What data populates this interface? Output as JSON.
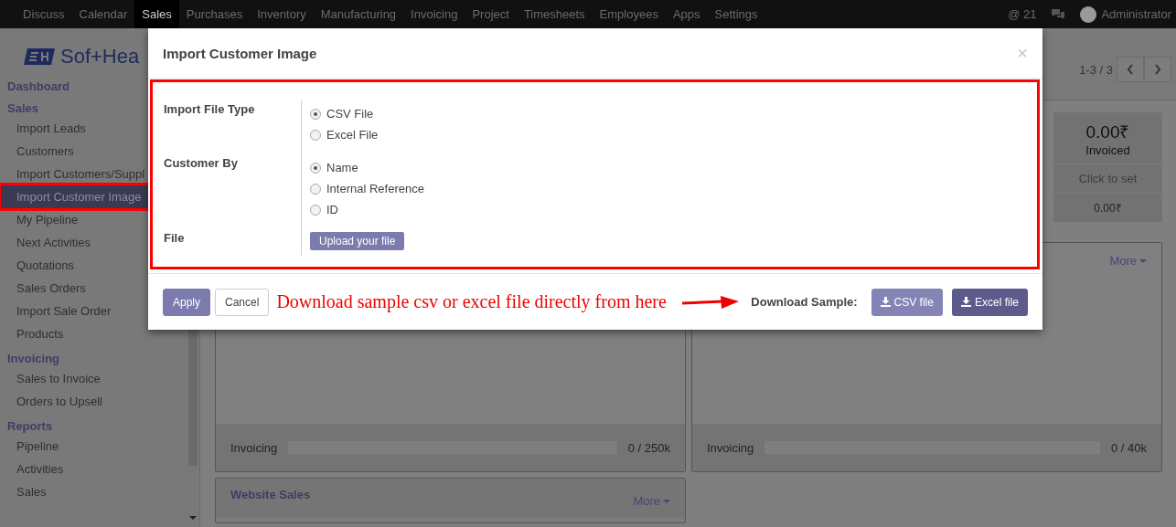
{
  "top_nav": {
    "menu": [
      {
        "label": "Discuss",
        "selected": false
      },
      {
        "label": "Calendar",
        "selected": false
      },
      {
        "label": "Sales",
        "selected": true
      },
      {
        "label": "Purchases",
        "selected": false
      },
      {
        "label": "Inventory",
        "selected": false
      },
      {
        "label": "Manufacturing",
        "selected": false
      },
      {
        "label": "Invoicing",
        "selected": false
      },
      {
        "label": "Project",
        "selected": false
      },
      {
        "label": "Timesheets",
        "selected": false
      },
      {
        "label": "Employees",
        "selected": false
      },
      {
        "label": "Apps",
        "selected": false
      },
      {
        "label": "Settings",
        "selected": false
      }
    ],
    "mentions": "@ 21",
    "user": "Administrator"
  },
  "logo": {
    "text": "Sof+Hea"
  },
  "sidebar": {
    "sections": [
      {
        "title": "Dashboard"
      },
      {
        "title": "Sales",
        "items": [
          {
            "label": "Import Leads",
            "selected": false
          },
          {
            "label": "Customers",
            "selected": false
          },
          {
            "label": "Import Customers/Suppl",
            "selected": false
          },
          {
            "label": "Import Customer Image",
            "selected": true
          },
          {
            "label": "My Pipeline",
            "selected": false
          },
          {
            "label": "Next Activities",
            "selected": false
          },
          {
            "label": "Quotations",
            "selected": false
          },
          {
            "label": "Sales Orders",
            "selected": false
          },
          {
            "label": "Import Sale Order",
            "selected": false
          },
          {
            "label": "Products",
            "selected": false
          }
        ]
      },
      {
        "title": "Invoicing",
        "items": [
          {
            "label": "Sales to Invoice",
            "selected": false
          },
          {
            "label": "Orders to Upsell",
            "selected": false
          }
        ]
      },
      {
        "title": "Reports",
        "items": [
          {
            "label": "Pipeline",
            "selected": false
          },
          {
            "label": "Activities",
            "selected": false
          },
          {
            "label": "Sales",
            "selected": false
          }
        ]
      }
    ]
  },
  "pager": "1-3 / 3",
  "stat_card": {
    "amount": "0.00₹",
    "label": "Invoiced",
    "target": "Click to set",
    "total": "0.00₹"
  },
  "cards": [
    {
      "invoicing": {
        "label": "Invoicing",
        "level": 0,
        "reading": "0 / 250k"
      }
    },
    {
      "more": "More",
      "invoicing": {
        "label": "Invoicing",
        "level": 0,
        "reading": "0 / 40k"
      }
    },
    {
      "title": "Website Sales",
      "more": "More"
    }
  ],
  "modal": {
    "title": "Import Customer Image",
    "close": "×",
    "fields": [
      {
        "label": "Import File Type",
        "kind": "radio",
        "options": [
          {
            "label": "CSV File",
            "selected": true
          },
          {
            "label": "Excel File",
            "selected": false
          }
        ]
      },
      {
        "label": "Customer By",
        "kind": "radio",
        "options": [
          {
            "label": "Name",
            "selected": true
          },
          {
            "label": "Internal Reference",
            "selected": false
          },
          {
            "label": "ID",
            "selected": false
          }
        ]
      },
      {
        "label": "File",
        "kind": "upload",
        "button": "Upload your file"
      }
    ],
    "apply": "Apply",
    "cancel": "Cancel",
    "annotation": "Download sample csv or excel file directly from here",
    "download_label": "Download Sample:",
    "download_buttons": [
      "CSV file",
      "Excel file"
    ]
  }
}
